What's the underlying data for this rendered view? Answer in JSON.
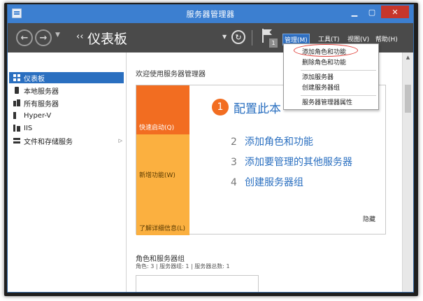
{
  "window": {
    "title": "服务器管理器",
    "controls": {
      "minimize": "▁",
      "maximize": "▢",
      "close": "✕"
    }
  },
  "header": {
    "nav_back": "←",
    "nav_forward": "→",
    "nav_dropdown": "▼",
    "breadcrumb_chevron": "‹‹",
    "page_title": "仪表板",
    "title_dropdown": "▼",
    "refresh": "↻",
    "notification_count": "1",
    "menus": [
      {
        "label": "管理(M)",
        "active": true
      },
      {
        "label": "工具(T)",
        "active": false
      },
      {
        "label": "视图(V)",
        "active": false
      },
      {
        "label": "帮助(H)",
        "active": false
      }
    ]
  },
  "sidebar": {
    "items": [
      {
        "label": "仪表板",
        "selected": true,
        "icon": "dashboard-icon"
      },
      {
        "label": "本地服务器",
        "selected": false,
        "icon": "server-icon"
      },
      {
        "label": "所有服务器",
        "selected": false,
        "icon": "servers-icon"
      },
      {
        "label": "Hyper-V",
        "selected": false,
        "icon": "hyperv-icon"
      },
      {
        "label": "IIS",
        "selected": false,
        "icon": "iis-icon"
      },
      {
        "label": "文件和存储服务",
        "selected": false,
        "icon": "file-storage-icon",
        "expand": "▷"
      }
    ]
  },
  "main": {
    "welcome": "欢迎使用服务器管理器",
    "tiles": [
      {
        "label": "快速启动(Q)"
      },
      {
        "label": "新增功能(W)"
      },
      {
        "label": "了解详细信息(L)"
      }
    ],
    "step1": {
      "number": "1",
      "text": "配置此本"
    },
    "steps": [
      {
        "number": "2",
        "text": "添加角色和功能"
      },
      {
        "number": "3",
        "text": "添加要管理的其他服务器"
      },
      {
        "number": "4",
        "text": "创建服务器组"
      }
    ],
    "hide": "隐藏",
    "roles_title": "角色和服务器组",
    "roles_summary": "角色: 3 | 服务器组: 1 | 服务器总数: 1"
  },
  "scrollbar": {
    "up": "▲"
  },
  "manage_menu": {
    "items": [
      {
        "label": "添加角色和功能"
      },
      {
        "label": "删除角色和功能"
      },
      {
        "label": "添加服务器"
      },
      {
        "label": "创建服务器组"
      },
      {
        "label": "服务器管理器属性"
      }
    ]
  },
  "colors": {
    "titlebar": "#3c7fd0",
    "header": "#4a4a4a",
    "accent_orange": "#f26d21",
    "tile_yellow": "#fbb040",
    "link_blue": "#2a6fc0",
    "highlight": "#e0403a"
  }
}
